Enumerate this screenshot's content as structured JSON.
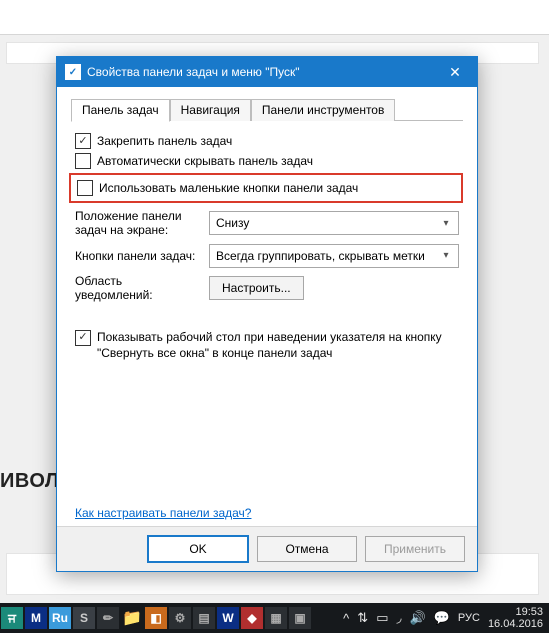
{
  "bg": {
    "left_label": "ИВОЛС"
  },
  "window": {
    "title": "Свойства панели задач и меню \"Пуск\""
  },
  "tabs": [
    "Панель задач",
    "Навигация",
    "Панели инструментов"
  ],
  "active_tab": 0,
  "taskbar_tab": {
    "lock_label": "Закрепить панель задач",
    "lock_checked": true,
    "autohide_label": "Автоматически скрывать панель задач",
    "autohide_checked": false,
    "smallbuttons_label": "Использовать маленькие кнопки панели задач",
    "smallbuttons_checked": false,
    "position_label": "Положение панели задач на экране:",
    "position_value": "Снизу",
    "buttons_label": "Кнопки панели задач:",
    "buttons_value": "Всегда группировать, скрывать метки",
    "notify_label": "Область уведомлений:",
    "notify_button": "Настроить...",
    "peek_checked": true,
    "peek_label": "Показывать рабочий стол при наведении указателя на кнопку \"Свернуть все окна\" в конце панели задач",
    "help_link": "Как настраивать панели задач?"
  },
  "buttons": {
    "ok": "OK",
    "cancel": "Отмена",
    "apply": "Применить"
  },
  "tray": {
    "up": "^",
    "lang": "РУС",
    "time": "19:53",
    "date": "16.04.2016"
  }
}
